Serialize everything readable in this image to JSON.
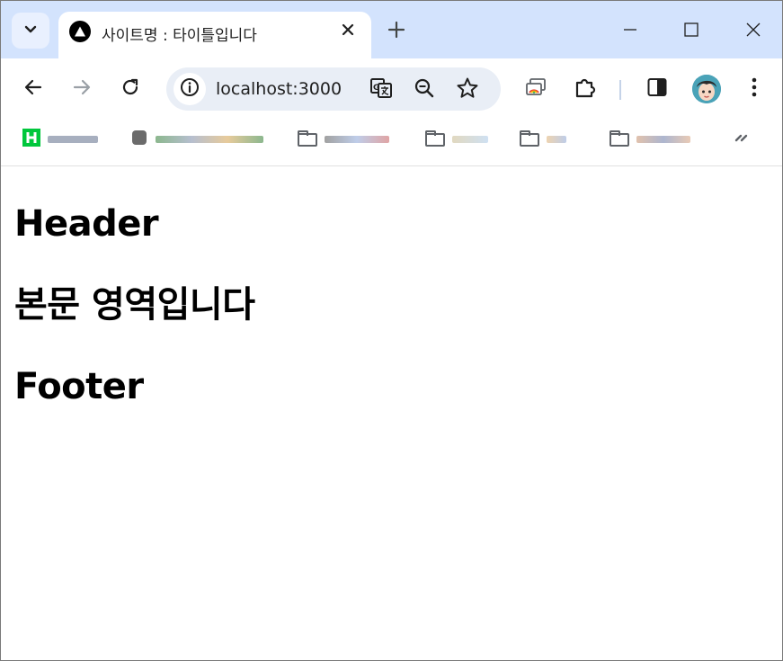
{
  "browser": {
    "tab": {
      "title": "사이트명 : 타이틀입니다"
    },
    "omnibox": {
      "url": "localhost:3000"
    },
    "icons": {
      "tab_search": "chevron-down-icon",
      "favicon": "triangle-logo-icon",
      "tab_close": "close-icon",
      "new_tab": "plus-icon",
      "minimize": "minimize-icon",
      "maximize": "maximize-icon",
      "close_window": "close-icon",
      "back": "arrow-left-icon",
      "forward": "arrow-right-icon",
      "reload": "reload-icon",
      "site_info": "info-icon",
      "translate": "translate-icon",
      "zoom": "zoom-out-icon",
      "bookmark_star": "star-icon",
      "cast": "cast-icon",
      "extensions": "puzzle-icon",
      "side_panel": "side-panel-icon",
      "profile": "avatar",
      "menu": "more-vert-icon"
    },
    "bookmarks": [
      {
        "icon": "app-h-icon"
      },
      {
        "icon": "app-icon"
      },
      {
        "icon": "folder-icon"
      },
      {
        "icon": "folder-icon"
      },
      {
        "icon": "folder-icon"
      },
      {
        "icon": "folder-icon"
      },
      {
        "icon": "overflow-icon"
      }
    ]
  },
  "page": {
    "header": "Header",
    "main": "본문 영역입니다",
    "footer": "Footer"
  },
  "colors": {
    "tabstrip_bg": "#d3e3fd",
    "omnibox_bg": "#e9eef6",
    "text": "#000000"
  }
}
